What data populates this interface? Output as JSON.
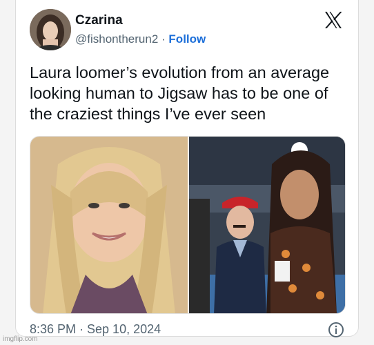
{
  "tweet": {
    "display_name": "Czarina",
    "handle": "@fishontherun2",
    "separator": "·",
    "follow_label": "Follow",
    "text": "Laura loomer’s evolution from an average looking human to Jigsaw has to be one of the craziest things I’ve ever seen",
    "timestamp": "8:36 PM · Sep 10, 2024"
  },
  "icons": {
    "brand": "x-logo-icon",
    "info": "info-icon"
  },
  "watermark": "imgflip.com",
  "colors": {
    "link": "#1d6fd9",
    "text": "#0f1419",
    "secondary": "#536471"
  }
}
